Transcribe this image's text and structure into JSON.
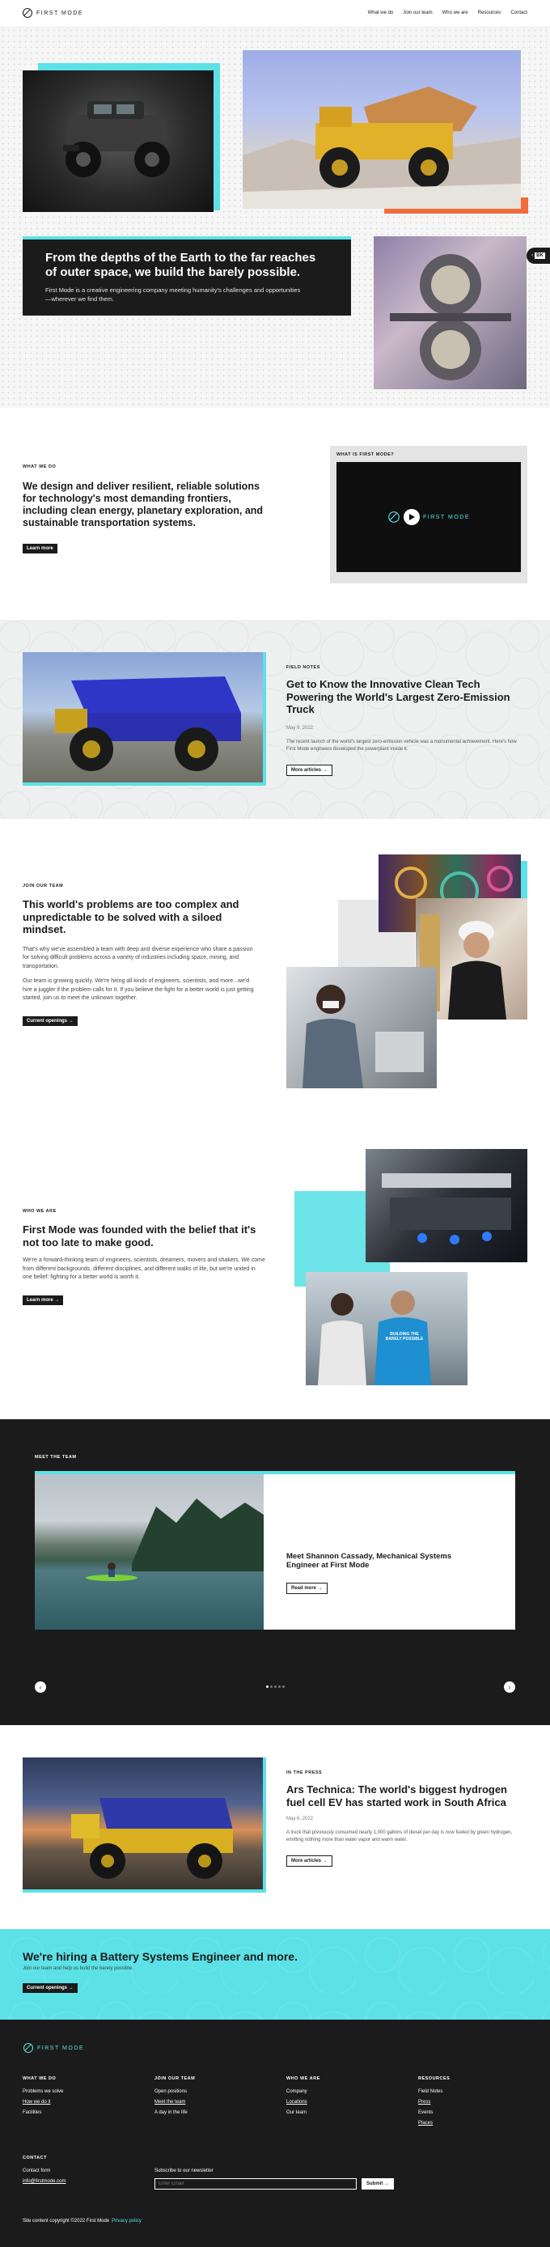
{
  "brand": {
    "name": "FIRST MODE"
  },
  "nav": {
    "items": [
      "What we do",
      "Join our team",
      "Who we are",
      "Resources",
      "Contact"
    ]
  },
  "hero": {
    "headline": "From the depths of the Earth to the far reaches of outer space, we build the barely possible.",
    "body": "First Mode is a creative engineering company meeting humanity's challenges and opportunities—wherever we find them.",
    "side_tab": "BK"
  },
  "what_we_do": {
    "eyebrow": "WHAT WE DO",
    "heading": "We design and deliver resilient, reliable solutions for technology's most demanding frontiers, including clean energy, planetary exploration, and sustainable transportation systems.",
    "button": "Learn more",
    "video_label": "WHAT IS FIRST MODE?",
    "video_brand": "FIRST MODE"
  },
  "field_notes": {
    "eyebrow": "FIELD NOTES",
    "heading": "Get to Know the Innovative Clean Tech Powering the World's Largest Zero-Emission Truck",
    "date": "May 9, 2022",
    "summary": "The recent launch of the world's largest zero-emission vehicle was a monumental achievement. Here's how First Mode engineers developed the powerplant inside it.",
    "button": "More articles"
  },
  "join": {
    "eyebrow": "JOIN OUR TEAM",
    "heading": "This world's problems are too complex and unpredictable to be solved with a siloed mindset.",
    "p1": "That's why we've assembled a team with deep and diverse experience who share a passion for solving difficult problems across a variety of industries including space, mining, and transportation.",
    "p2": "Our team is growing quickly. We're hiring all kinds of engineers, scientists, and more...we'd hire a juggler if the problem calls for it. If you believe the fight for a better world is just getting started, join us to meet the unknown together.",
    "button": "Current openings"
  },
  "who": {
    "eyebrow": "WHO WE ARE",
    "heading": "First Mode was founded with the belief that it's not too late to make good.",
    "body": "We're a forward-thinking team of engineers, scientists, dreamers, movers and shakers. We come from different backgrounds, different disciplines, and different walks of life, but we're united in one belief: fighting for a better world is worth it.",
    "button": "Learn more",
    "shirt_text": "BUILDING THE BARELY POSSIBLE"
  },
  "meet": {
    "eyebrow": "MEET THE TEAM",
    "caption": "Meet Shannon Cassady, Mechanical Systems Engineer at First Mode",
    "button": "Read more",
    "dots": 5,
    "active_dot": 0
  },
  "press": {
    "eyebrow": "IN THE PRESS",
    "heading": "Ars Technica: The world's biggest hydrogen fuel cell EV has started work in South Africa",
    "date": "May 6, 2022",
    "summary": "A truck that previously consumed nearly 1,000 gallons of diesel per day is now fueled by green hydrogen, emitting nothing more than water vapor and warm water.",
    "button": "More articles"
  },
  "hiring": {
    "heading": "We're hiring a Battery Systems Engineer and more.",
    "sub": "Join our team and help us build the barely possible.",
    "button": "Current openings"
  },
  "footer": {
    "columns": [
      {
        "title": "WHAT WE DO",
        "links": [
          "Problems we solve",
          "How we do it",
          "Facilities"
        ]
      },
      {
        "title": "JOIN OUR TEAM",
        "links": [
          "Open positions",
          "Meet the team",
          "A day in the life"
        ]
      },
      {
        "title": "WHO WE ARE",
        "links": [
          "Company",
          "Locations",
          "Our team"
        ]
      },
      {
        "title": "RESOURCES",
        "links": [
          "Field Notes",
          "Press",
          "Events",
          "Places"
        ]
      }
    ],
    "contact_title": "CONTACT",
    "contact_form": "Contact form",
    "email": "info@firstmode.com",
    "newsletter_label": "Subscribe to our newsletter",
    "email_placeholder": "Enter Email",
    "submit": "Submit",
    "copyright": "Site content copyright ©2022 First Mode",
    "privacy": "Privacy policy"
  },
  "colors": {
    "accent_cyan": "#5ce1e6",
    "accent_orange": "#f26b3a",
    "dark": "#1b1b1b"
  }
}
